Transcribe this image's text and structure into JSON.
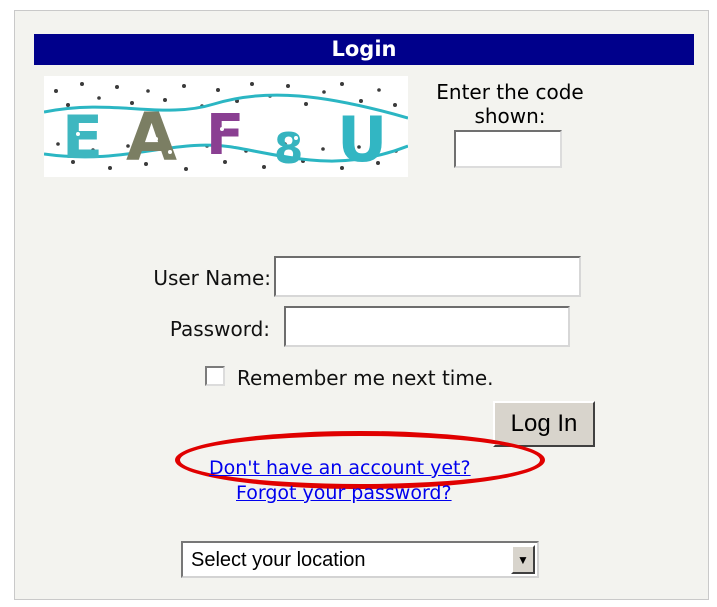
{
  "header": {
    "title": "Login"
  },
  "captcha": {
    "code_label": "Enter the code shown:",
    "code_value": "",
    "code_placeholder": ""
  },
  "login": {
    "username_label": "User Name:",
    "username_value": "",
    "password_label": "Password:",
    "password_value": "",
    "remember_label": "Remember me next time.",
    "login_button": "Log In"
  },
  "links": {
    "signup": "Don't have an account yet?",
    "forgot": "Forgot your password?"
  },
  "location": {
    "selected": "Select your location"
  }
}
